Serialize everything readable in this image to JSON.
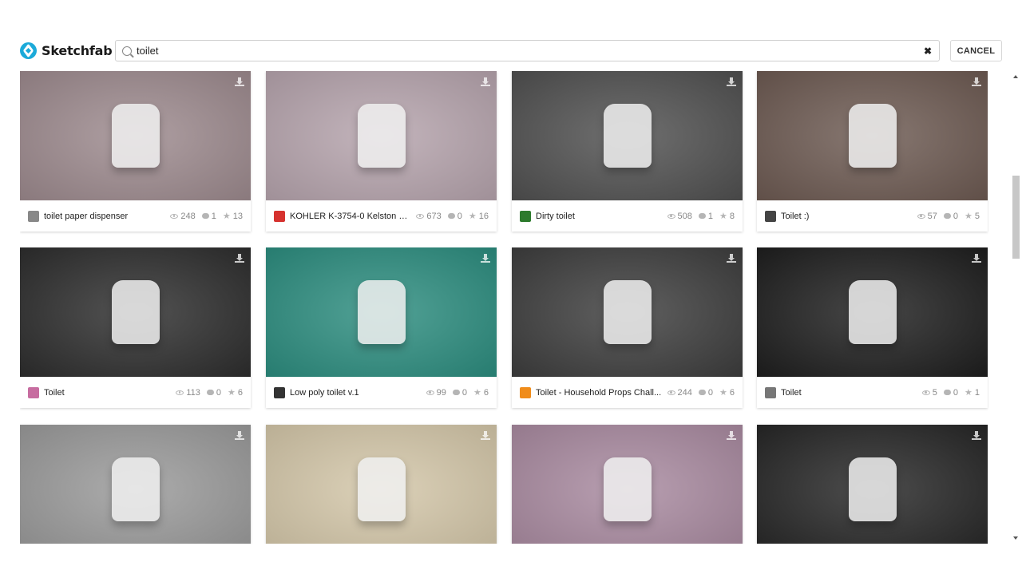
{
  "header": {
    "logo_text": "Sketchfab",
    "search_value": "toilet",
    "cancel_label": "CANCEL"
  },
  "models": [
    {
      "title": "toilet paper dispenser",
      "views": "248",
      "comments": "1",
      "likes": "13",
      "bg": "#9d8a8e",
      "avatar": "#888"
    },
    {
      "title": "KOHLER K-3754-0 Kelston Co...",
      "views": "673",
      "comments": "0",
      "likes": "16",
      "bg": "#b6a4ad",
      "avatar": "#d6322f"
    },
    {
      "title": "Dirty toilet",
      "views": "508",
      "comments": "1",
      "likes": "8",
      "bg": "#505050",
      "avatar": "#2c7a2c"
    },
    {
      "title": "Toilet :)",
      "views": "57",
      "comments": "0",
      "likes": "5",
      "bg": "#6d5a52",
      "avatar": "#444"
    },
    {
      "title": "Toilet",
      "views": "113",
      "comments": "0",
      "likes": "6",
      "bg": "#2d2d2d",
      "avatar": "#c76ca0"
    },
    {
      "title": "Low poly toilet v.1",
      "views": "99",
      "comments": "0",
      "likes": "6",
      "bg": "#2c8d7f",
      "avatar": "#333"
    },
    {
      "title": "Toilet - Household Props Chall...",
      "views": "244",
      "comments": "0",
      "likes": "6",
      "bg": "#3d3d3d",
      "avatar": "#f08c1a"
    },
    {
      "title": "Toilet",
      "views": "5",
      "comments": "0",
      "likes": "1",
      "bg": "#1e1e1e",
      "avatar": "#777"
    },
    {
      "title": "",
      "views": "",
      "comments": "",
      "likes": "",
      "bg": "#9a9a9a",
      "avatar": "#888"
    },
    {
      "title": "",
      "views": "",
      "comments": "",
      "likes": "",
      "bg": "#d4c7a9",
      "avatar": "#888"
    },
    {
      "title": "",
      "views": "",
      "comments": "",
      "likes": "",
      "bg": "#a98aa0",
      "avatar": "#888"
    },
    {
      "title": "",
      "views": "",
      "comments": "",
      "likes": "",
      "bg": "#262626",
      "avatar": "#888"
    }
  ]
}
